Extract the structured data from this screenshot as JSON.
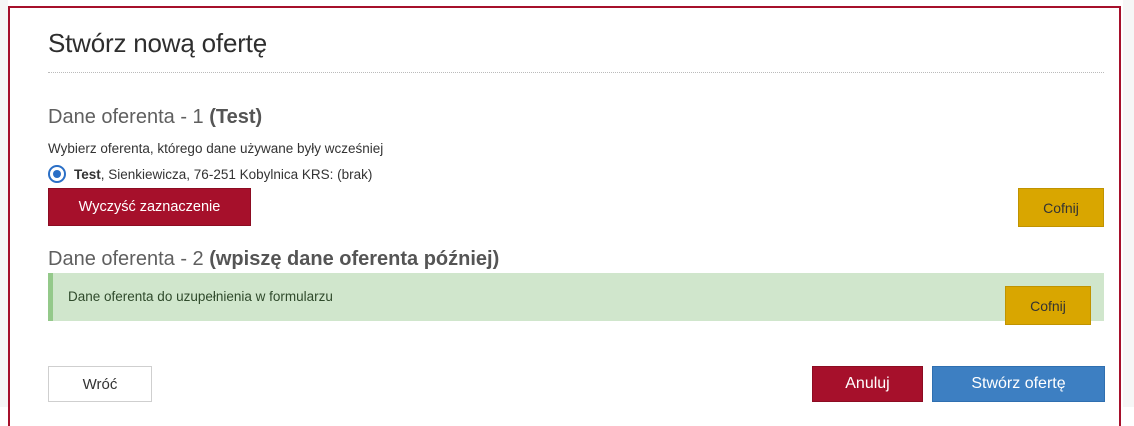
{
  "dialog": {
    "title": "Stwórz nową ofertę"
  },
  "offeror1": {
    "heading_prefix": "Dane oferenta - 1 ",
    "heading_bold": "(Test)",
    "hint": "Wybierz oferenta, którego dane używane były wcześniej",
    "option_name": "Test",
    "option_details": ", Sienkiewicza, 76-251 Kobylnica KRS: (brak)",
    "option_selected": true,
    "clear_label": "Wyczyść zaznaczenie",
    "back_label": "Cofnij"
  },
  "offeror2": {
    "heading_prefix": "Dane oferenta - 2 ",
    "heading_bold": "(wpiszę dane oferenta później)",
    "alert_text": "Dane oferenta do uzupełnienia w formularzu",
    "back_label": "Cofnij"
  },
  "footer": {
    "back_label": "Wróć",
    "cancel_label": "Anuluj",
    "create_label": "Stwórz ofertę"
  },
  "colors": {
    "primary_red": "#a6102b",
    "warning_yellow": "#d9a600",
    "primary_blue": "#3d7fc2",
    "success_bg": "#d0e6cc"
  }
}
